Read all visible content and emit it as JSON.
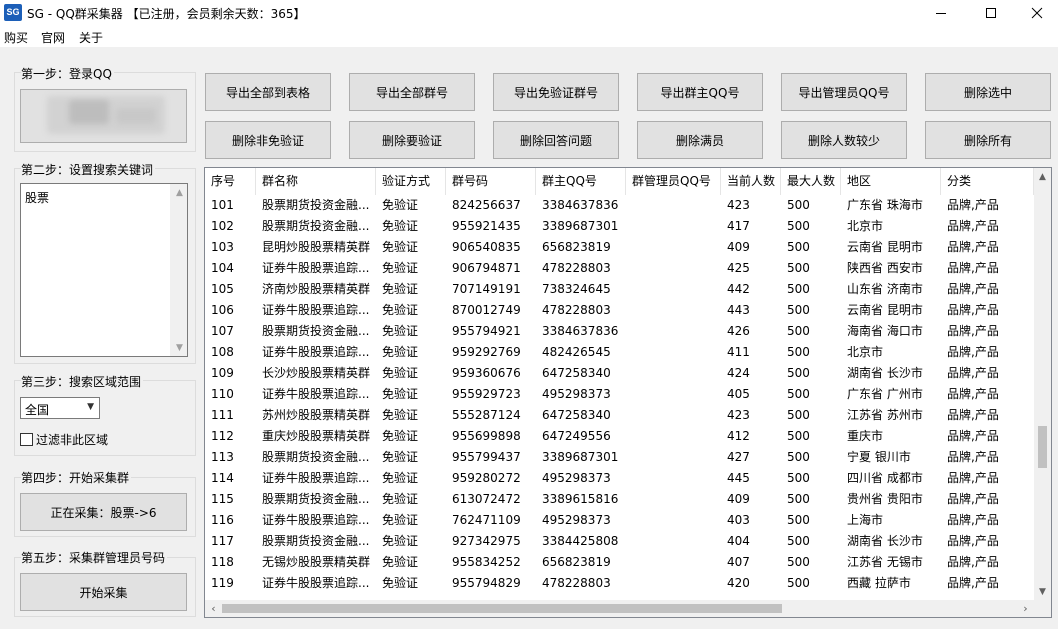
{
  "window": {
    "title": "SG - QQ群采集器 【已注册，会员剩余天数：365】",
    "icon_label": "SG",
    "icon_color": "#1c5fb8"
  },
  "menu": [
    "购买",
    "官网",
    "关于"
  ],
  "left": {
    "step1": {
      "title": "第一步：登录QQ"
    },
    "step2": {
      "title": "第二步：设置搜索关键词",
      "keyword": "股票"
    },
    "step3": {
      "title": "第三步：搜索区域范围",
      "region": "全国",
      "filter_label": "过滤非此区域"
    },
    "step4": {
      "title": "第四步：开始采集群",
      "button": "正在采集：股票->6"
    },
    "step5": {
      "title": "第五步：采集群管理员号码",
      "button": "开始采集"
    }
  },
  "toolbar": {
    "row1": [
      "导出全部到表格",
      "导出全部群号",
      "导出免验证群号",
      "导出群主QQ号",
      "导出管理员QQ号",
      "删除选中"
    ],
    "row2": [
      "删除非免验证",
      "删除要验证",
      "删除回答问题",
      "删除满员",
      "删除人数较少",
      "删除所有"
    ]
  },
  "table": {
    "columns": [
      "序号",
      "群名称",
      "验证方式",
      "群号码",
      "群主QQ号",
      "群管理员QQ号",
      "当前人数",
      "最大人数",
      "地区",
      "分类"
    ],
    "rows": [
      [
        "101",
        "股票期货投资金融...",
        "免验证",
        "824256637",
        "3384637836",
        "",
        "423",
        "500",
        "广东省 珠海市",
        "品牌,产品"
      ],
      [
        "102",
        "股票期货投资金融...",
        "免验证",
        "955921435",
        "3389687301",
        "",
        "417",
        "500",
        "北京市",
        "品牌,产品"
      ],
      [
        "103",
        "昆明炒股股票精英群",
        "免验证",
        "906540835",
        "656823819",
        "",
        "409",
        "500",
        "云南省 昆明市",
        "品牌,产品"
      ],
      [
        "104",
        "证券牛股股票追踪...",
        "免验证",
        "906794871",
        "478228803",
        "",
        "425",
        "500",
        "陕西省 西安市",
        "品牌,产品"
      ],
      [
        "105",
        "济南炒股股票精英群",
        "免验证",
        "707149191",
        "738324645",
        "",
        "442",
        "500",
        "山东省 济南市",
        "品牌,产品"
      ],
      [
        "106",
        "证券牛股股票追踪...",
        "免验证",
        "870012749",
        "478228803",
        "",
        "443",
        "500",
        "云南省 昆明市",
        "品牌,产品"
      ],
      [
        "107",
        "股票期货投资金融...",
        "免验证",
        "955794921",
        "3384637836",
        "",
        "426",
        "500",
        "海南省 海口市",
        "品牌,产品"
      ],
      [
        "108",
        "证券牛股股票追踪...",
        "免验证",
        "959292769",
        "482426545",
        "",
        "411",
        "500",
        "北京市",
        "品牌,产品"
      ],
      [
        "109",
        "长沙炒股股票精英群",
        "免验证",
        "959360676",
        "647258340",
        "",
        "424",
        "500",
        "湖南省 长沙市",
        "品牌,产品"
      ],
      [
        "110",
        "证券牛股股票追踪...",
        "免验证",
        "955929723",
        "495298373",
        "",
        "405",
        "500",
        "广东省 广州市",
        "品牌,产品"
      ],
      [
        "111",
        "苏州炒股股票精英群",
        "免验证",
        "555287124",
        "647258340",
        "",
        "423",
        "500",
        "江苏省 苏州市",
        "品牌,产品"
      ],
      [
        "112",
        "重庆炒股股票精英群",
        "免验证",
        "955699898",
        "647249556",
        "",
        "412",
        "500",
        "重庆市",
        "品牌,产品"
      ],
      [
        "113",
        "股票期货投资金融...",
        "免验证",
        "955799437",
        "3389687301",
        "",
        "427",
        "500",
        "宁夏 银川市",
        "品牌,产品"
      ],
      [
        "114",
        "证券牛股股票追踪...",
        "免验证",
        "959280272",
        "495298373",
        "",
        "445",
        "500",
        "四川省 成都市",
        "品牌,产品"
      ],
      [
        "115",
        "股票期货投资金融...",
        "免验证",
        "613072472",
        "3389615816",
        "",
        "409",
        "500",
        "贵州省 贵阳市",
        "品牌,产品"
      ],
      [
        "116",
        "证券牛股股票追踪...",
        "免验证",
        "762471109",
        "495298373",
        "",
        "403",
        "500",
        "上海市",
        "品牌,产品"
      ],
      [
        "117",
        "股票期货投资金融...",
        "免验证",
        "927342975",
        "3384425808",
        "",
        "404",
        "500",
        "湖南省 长沙市",
        "品牌,产品"
      ],
      [
        "118",
        "无锡炒股股票精英群",
        "免验证",
        "955834252",
        "656823819",
        "",
        "407",
        "500",
        "江苏省 无锡市",
        "品牌,产品"
      ],
      [
        "119",
        "证券牛股股票追踪...",
        "免验证",
        "955794829",
        "478228803",
        "",
        "420",
        "500",
        "西藏 拉萨市",
        "品牌,产品"
      ]
    ]
  }
}
